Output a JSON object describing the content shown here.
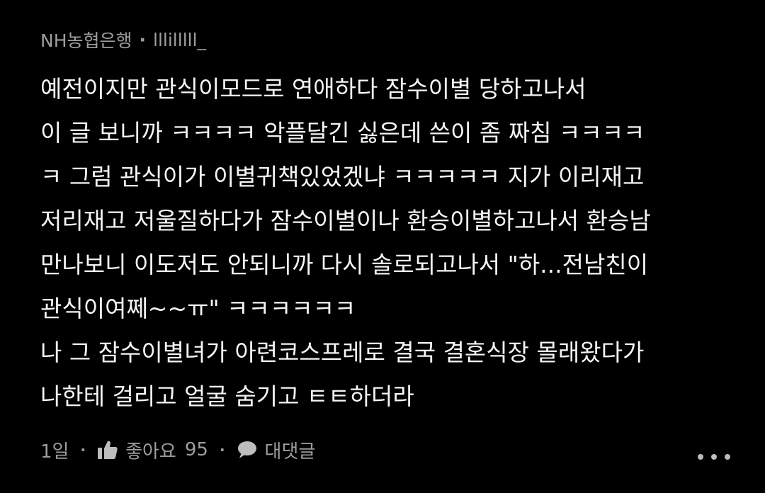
{
  "comment": {
    "board": "NH농협은행",
    "separator": "·",
    "author": "lllilllll_",
    "lines": [
      "예전이지만 관식이모드로 연애하다 잠수이별 당하고나서",
      "이 글 보니까 ㅋㅋㅋㅋ 악플달긴 싫은데 쓴이 좀 짜침 ㅋㅋㅋㅋ",
      "ㅋ 그럼 관식이가 이별귀책있었겠냐 ㅋㅋㅋㅋㅋ 지가 이리재고",
      "저리재고 저울질하다가 잠수이별이나 환승이별하고나서 환승남",
      "만나보니 이도저도 안되니까 다시 솔로되고나서 \"하...전남친이",
      "관식이여쩨~~ㅠ\" ㅋㅋㅋㅋㅋㅋ",
      "나 그 잠수이별녀가 아련코스프레로 결국 결혼식장 몰래왔다가",
      "나한테 걸리고 얼굴 숨기고 ㅌㅌ하더라"
    ],
    "time": "1일",
    "like_label": "좋아요",
    "like_count": "95",
    "reply_label": "대댓글"
  },
  "colors": {
    "background": "#000000",
    "text": "#f5f5f5",
    "meta": "#9e9e9e"
  },
  "icons": {
    "like": "thumbs-up-icon",
    "reply": "speech-bubble-icon",
    "more": "more-dots-icon"
  }
}
